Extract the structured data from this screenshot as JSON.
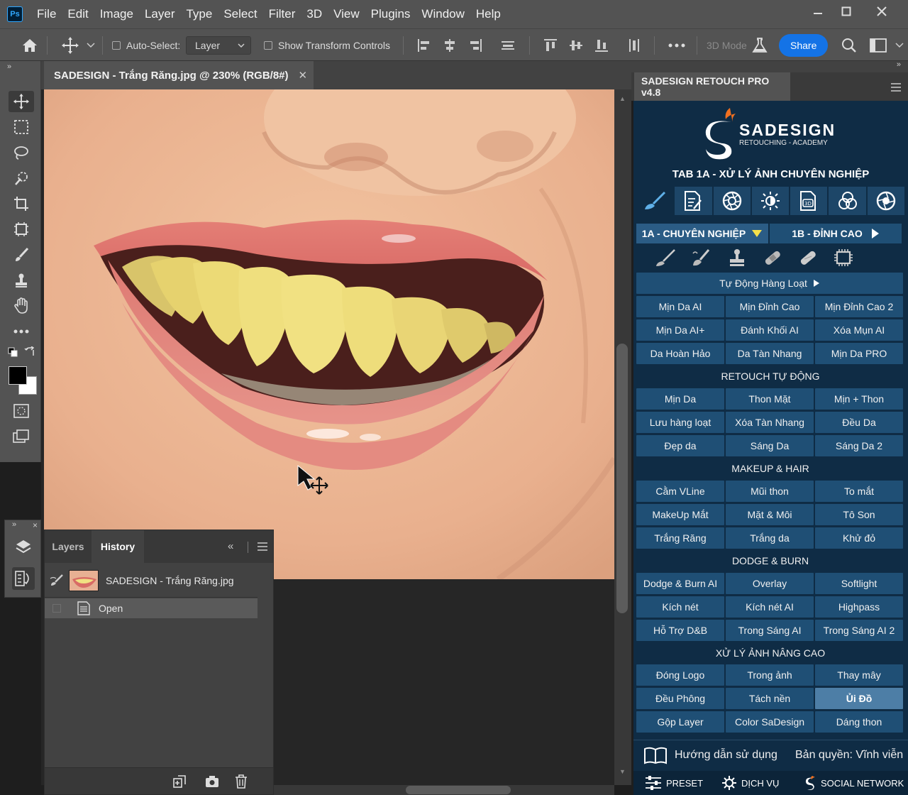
{
  "menubar": {
    "items": [
      "File",
      "Edit",
      "Image",
      "Layer",
      "Type",
      "Select",
      "Filter",
      "3D",
      "View",
      "Plugins",
      "Window",
      "Help"
    ],
    "app_logo": "Ps"
  },
  "options": {
    "auto_select_label": "Auto-Select:",
    "auto_select_checked": false,
    "layer_select_value": "Layer",
    "show_transform_label": "Show Transform Controls",
    "show_transform_checked": false,
    "mode_3d_label": "3D Mode",
    "share_label": "Share"
  },
  "document": {
    "tab_title": "SADESIGN - Trắng Răng.jpg @ 230% (RGB/8#)"
  },
  "history_panel": {
    "tabs": [
      "Layers",
      "History"
    ],
    "active_tab": "History",
    "snapshot_label": "SADESIGN - Trắng Răng.jpg",
    "states": [
      "Open"
    ]
  },
  "right_panel": {
    "tab_title": "SADESIGN RETOUCH PRO v4.8",
    "brand_name": "SADESIGN",
    "brand_sub": "RETOUCHING - ACADEMY",
    "tab_heading": "TAB 1A - XỬ LÝ ẢNH CHUYÊN NGHIỆP",
    "subtabs": [
      "1A - CHUYÊN NGHIỆP",
      "1B - ĐỈNH CAO"
    ],
    "auto_batch": "Tự Động Hàng Loạt",
    "group1": [
      "Mịn Da AI",
      "Mịn Đỉnh Cao",
      "Mịn Đỉnh Cao 2",
      "Mịn Da AI+",
      "Đánh Khối AI",
      "Xóa Mụn AI",
      "Da Hoàn Hảo",
      "Da Tàn Nhang",
      "Mịn Da PRO"
    ],
    "section_retouch": "RETOUCH TỰ ĐỘNG",
    "group2": [
      "Mịn Da",
      "Thon Mặt",
      "Mịn + Thon",
      "Lưu hàng loạt",
      "Xóa Tàn Nhang",
      "Đều Da",
      "Đẹp da",
      "Sáng Da",
      "Sáng Da 2"
    ],
    "section_makeup": "MAKEUP & HAIR",
    "group3": [
      "Cằm VLine",
      "Mũi thon",
      "To mắt",
      "MakeUp Mắt",
      "Mặt & Môi",
      "Tô Son",
      "Trắng Răng",
      "Trắng da",
      "Khử đỏ"
    ],
    "section_dodge": "DODGE & BURN",
    "group4": [
      "Dodge & Burn AI",
      "Overlay",
      "Softlight",
      "Kích nét",
      "Kích nét AI",
      "Highpass",
      "Hỗ Trợ D&B",
      "Trong Sáng AI",
      "Trong Sáng AI 2"
    ],
    "section_advanced": "XỬ LÝ ẢNH NÂNG CAO",
    "group5": [
      "Đóng Logo",
      "Trong ảnh",
      "Thay mây",
      "Đều Phông",
      "Tách nền",
      "Ủi Đồ",
      "Gộp Layer",
      "Color SaDesign",
      "Dáng thon"
    ],
    "highlighted_button": "Ủi Đồ",
    "guide_label": "Hướng dẫn sử dụng",
    "license_label": "Bản quyền: Vĩnh viễn",
    "footer": [
      "PRESET",
      "DỊCH VỤ",
      "SOCIAL NETWORK"
    ]
  },
  "colors": {
    "panel_bg": "#0f2c45",
    "button_bg": "#1f4f75",
    "button_highlight": "#4d7ea6",
    "accent_blue": "#1473e6",
    "triangle_yellow": "#f5e04a"
  }
}
